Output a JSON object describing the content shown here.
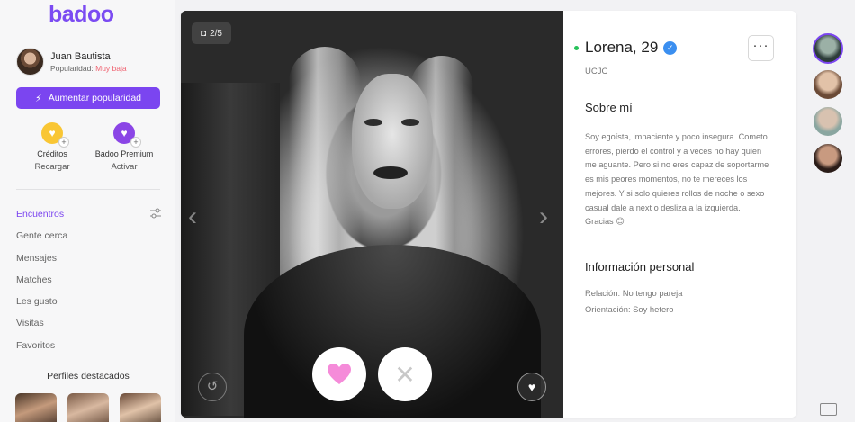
{
  "brand": "badoo",
  "user": {
    "name": "Juan Bautista",
    "popularity_label": "Popularidad:",
    "popularity_value": "Muy baja"
  },
  "boost_button": "Aumentar popularidad",
  "wallet": [
    {
      "title": "Créditos",
      "action": "Recargar",
      "icon": "heart-coin-icon",
      "color": "#f9c634"
    },
    {
      "title": "Badoo Premium",
      "action": "Activar",
      "icon": "premium-heart-icon",
      "color": "#8b45e6"
    }
  ],
  "nav": [
    {
      "label": "Encuentros",
      "active": true
    },
    {
      "label": "Gente cerca"
    },
    {
      "label": "Mensajes"
    },
    {
      "label": "Matches"
    },
    {
      "label": "Les gusto"
    },
    {
      "label": "Visitas"
    },
    {
      "label": "Favoritos"
    }
  ],
  "featured_title": "Perfiles destacados",
  "photo": {
    "counter": "2/5"
  },
  "profile": {
    "name_age": "Lorena, 29",
    "location": "UCJC",
    "about_heading": "Sobre mí",
    "bio": "Soy egoísta, impaciente y poco insegura. Cometo errores, pierdo el control y a veces no hay quien me aguante. Pero si no eres capaz de soportarme es mis peores momentos, no te mereces los mejores. Y si solo quieres rollos de noche o sexo casual dale a next o desliza a la izquierda. Gracias 😊",
    "info_heading": "Información personal",
    "relationship": "Relación: No tengo pareja",
    "orientation": "Orientación: Soy hetero"
  },
  "colors": {
    "accent": "#7b45f0",
    "online": "#27c25a",
    "like_heart": "#f58bd9",
    "low_popularity": "#f06573"
  }
}
